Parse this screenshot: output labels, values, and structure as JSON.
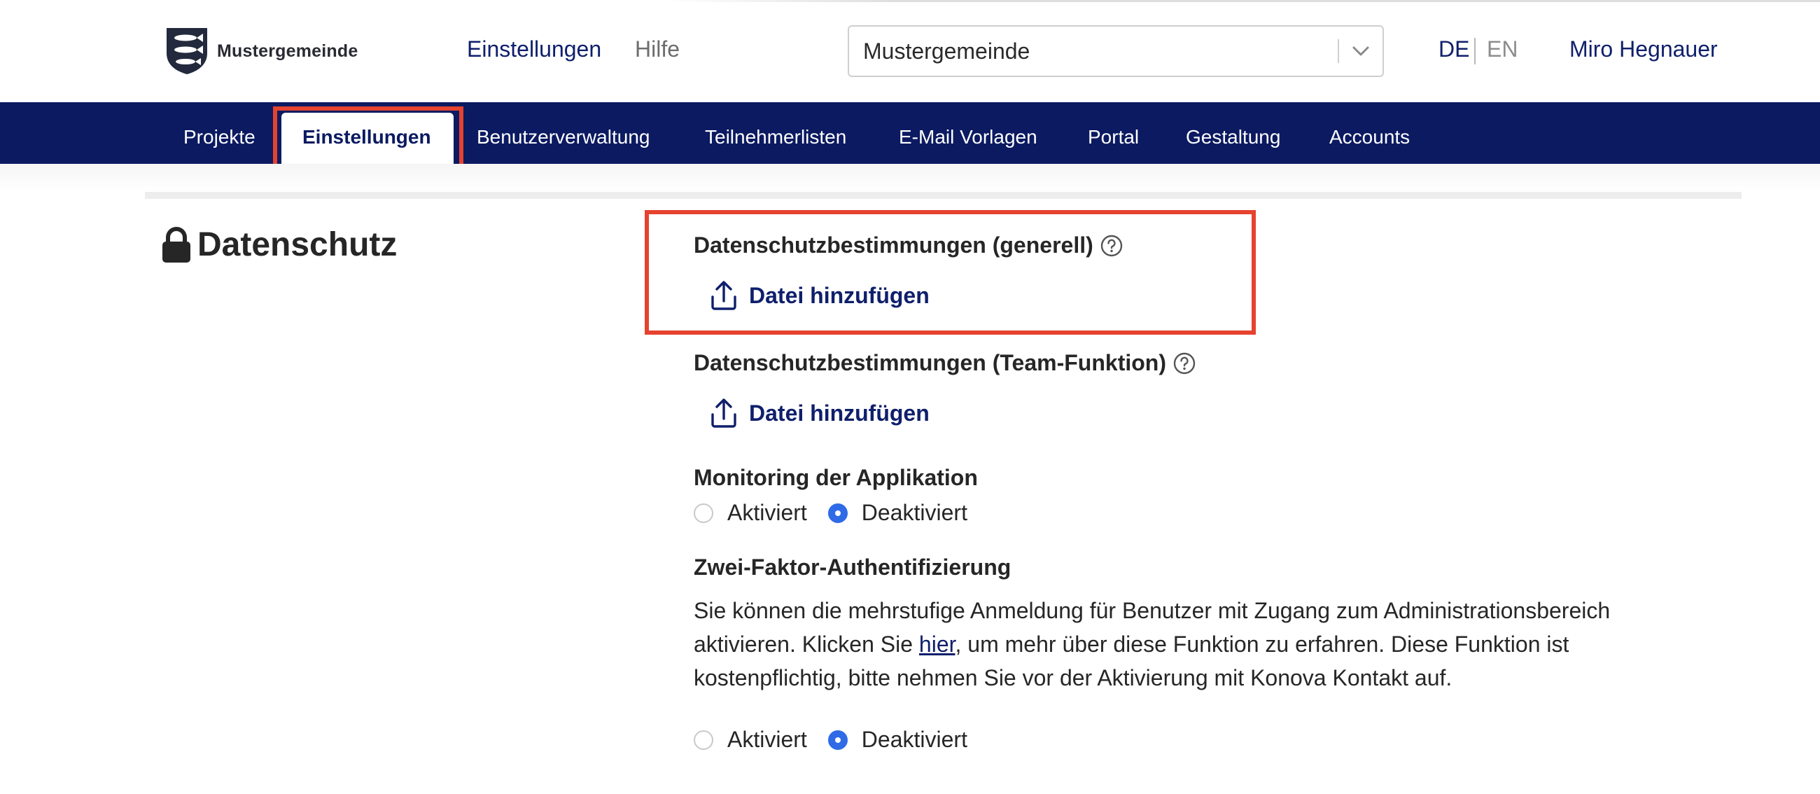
{
  "header": {
    "logo_text": "Mustergemeinde",
    "nav": {
      "settings": "Einstellungen",
      "help": "Hilfe"
    },
    "org_select": {
      "value": "Mustergemeinde"
    },
    "language": {
      "active": "DE",
      "inactive": "EN"
    },
    "user_name": "Miro Hegnauer"
  },
  "navbar": {
    "items": [
      {
        "label": "Projekte"
      },
      {
        "label": "Einstellungen",
        "active": true
      },
      {
        "label": "Benutzerverwaltung"
      },
      {
        "label": "Teilnehmerlisten"
      },
      {
        "label": "E-Mail Vorlagen"
      },
      {
        "label": "Portal"
      },
      {
        "label": "Gestaltung"
      },
      {
        "label": "Accounts"
      }
    ]
  },
  "section": {
    "title": "Datenschutz",
    "icon": "lock-icon",
    "privacy_general": {
      "label": "Datenschutzbestimmungen (generell)",
      "upload_label": "Datei hinzufügen"
    },
    "privacy_team": {
      "label": "Datenschutzbestimmungen (Team-Funktion)",
      "upload_label": "Datei hinzufügen"
    },
    "monitoring": {
      "label": "Monitoring der Applikation",
      "option_on": "Aktiviert",
      "option_off": "Deaktiviert",
      "selected": "Deaktiviert"
    },
    "two_factor": {
      "label": "Zwei-Faktor-Authentifizierung",
      "description_before": "Sie können die mehrstufige Anmeldung für Benutzer mit Zugang zum Administrationsbereich aktivieren. Klicken Sie ",
      "link_text": "hier",
      "description_after": ", um mehr über diese Funktion zu erfahren. Diese Funktion ist kostenpflichtig, bitte nehmen Sie vor der Aktivierung mit Konova Kontakt auf.",
      "option_on": "Aktiviert",
      "option_off": "Deaktiviert",
      "selected": "Deaktiviert"
    }
  },
  "colors": {
    "navbar": "#0b1a61",
    "primary_text": "#0f1f6b",
    "highlight": "#e5432f",
    "radio_selected": "#2f6be6"
  }
}
